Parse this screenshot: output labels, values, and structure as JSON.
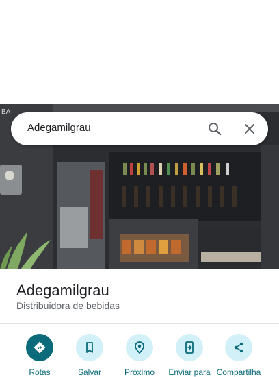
{
  "search": {
    "query": "Adegamilgrau"
  },
  "place": {
    "name": "Adegamilgrau",
    "category": "Distribuidora de bebidas"
  },
  "actions": [
    {
      "label": "Rotas",
      "icon": "directions-icon"
    },
    {
      "label": "Salvar",
      "icon": "bookmark-icon"
    },
    {
      "label": "Próximo",
      "icon": "nearby-icon"
    },
    {
      "label": "Enviar para",
      "icon": "send-to-phone-icon"
    },
    {
      "label": "Compartilha",
      "icon": "share-icon"
    }
  ],
  "colors": {
    "accent": "#0b6b7a",
    "accent_light": "#d2f0f7"
  }
}
